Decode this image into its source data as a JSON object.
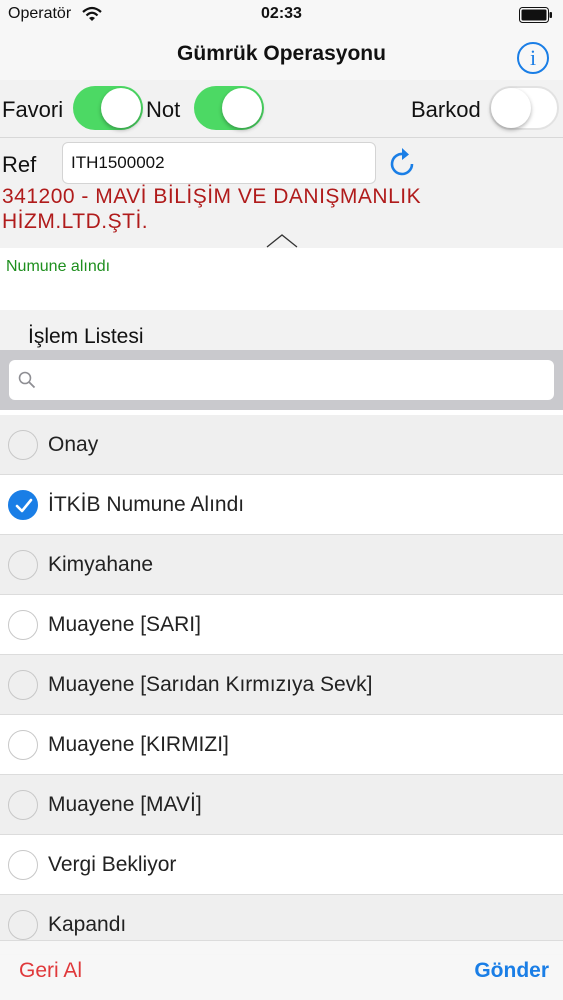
{
  "status_bar": {
    "carrier": "Operatör",
    "time": "02:33"
  },
  "nav": {
    "title": "Gümrük Operasyonu",
    "info_icon": "info-icon"
  },
  "toggles": {
    "favori": {
      "label": "Favori",
      "on": true
    },
    "not": {
      "label": "Not",
      "on": true
    },
    "barkod": {
      "label": "Barkod",
      "on": false
    }
  },
  "ref": {
    "label": "Ref",
    "value": "ITH1500002"
  },
  "company": "341200 - MAVİ BİLİŞİM VE DANIŞMANLIK HİZM.LTD.ŞTİ.",
  "note": "Numune alındı",
  "list_header": "İşlem Listesi",
  "search": {
    "placeholder": ""
  },
  "operations": [
    {
      "label": "Onay",
      "selected": false
    },
    {
      "label": "İTKİB Numune Alındı",
      "selected": true
    },
    {
      "label": "Kimyahane",
      "selected": false
    },
    {
      "label": "Muayene [SARI]",
      "selected": false
    },
    {
      "label": "Muayene [Sarıdan Kırmızıya Sevk]",
      "selected": false
    },
    {
      "label": "Muayene [KIRMIZI]",
      "selected": false
    },
    {
      "label": "Muayene [MAVİ]",
      "selected": false
    },
    {
      "label": "Vergi Bekliyor",
      "selected": false
    },
    {
      "label": "Kapandı",
      "selected": false
    }
  ],
  "toolbar": {
    "back_label": "Geri Al",
    "send_label": "Gönder"
  },
  "colors": {
    "accent": "#1a7ee6",
    "toggle_on": "#4cd964",
    "company_text": "#b01b1b",
    "note_text": "#1e8f1e",
    "back_text": "#e0393b"
  }
}
